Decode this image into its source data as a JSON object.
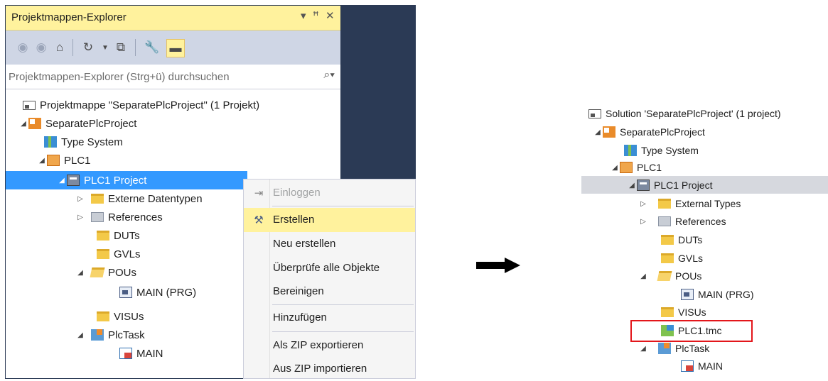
{
  "explorer": {
    "title": "Projektmappen-Explorer",
    "title_controls": [
      "▾",
      "ꟸ",
      "✕"
    ],
    "search_placeholder": "Projektmappen-Explorer (Strg+ü) durchsuchen",
    "tree": [
      {
        "label": "Projektmappe \"SeparatePlcProject\" (1 Projekt)",
        "icon": "solution-icon",
        "arrow": ""
      },
      {
        "label": "SeparatePlcProject",
        "icon": "project-icon",
        "arrow": "◢"
      },
      {
        "label": "Type System",
        "icon": "type-system-icon",
        "arrow": ""
      },
      {
        "label": "PLC1",
        "icon": "plc-icon",
        "arrow": "◢"
      },
      {
        "label": "PLC1 Project",
        "icon": "plc-project-icon",
        "arrow": "◢"
      },
      {
        "label": "Externe Datentypen",
        "icon": "folder-icon",
        "arrow": "▷"
      },
      {
        "label": "References",
        "icon": "references-icon",
        "arrow": "▷"
      },
      {
        "label": "DUTs",
        "icon": "folder-icon",
        "arrow": ""
      },
      {
        "label": "GVLs",
        "icon": "folder-icon",
        "arrow": ""
      },
      {
        "label": "POUs",
        "icon": "folder-open-icon",
        "arrow": "◢"
      },
      {
        "label": "MAIN (PRG)",
        "icon": "program-icon",
        "arrow": ""
      },
      {
        "label": "VISUs",
        "icon": "folder-icon",
        "arrow": ""
      },
      {
        "label": "PlcTask",
        "icon": "task-icon",
        "arrow": "◢"
      },
      {
        "label": "MAIN",
        "icon": "main-call-icon",
        "arrow": ""
      }
    ]
  },
  "context_menu": {
    "items": [
      {
        "label": "Einloggen",
        "icon": "login-icon",
        "disabled": true
      },
      {
        "label": "Erstellen",
        "icon": "build-icon",
        "highlighted": true
      },
      {
        "label": "Neu erstellen"
      },
      {
        "label": "Überprüfe alle Objekte"
      },
      {
        "label": "Bereinigen"
      },
      {
        "label": "Hinzufügen"
      },
      {
        "label": "Als ZIP exportieren"
      },
      {
        "label": "Aus ZIP importieren"
      }
    ]
  },
  "result_tree": [
    {
      "label": "Solution 'SeparatePlcProject' (1 project)",
      "icon": "solution-icon",
      "arrow": ""
    },
    {
      "label": "SeparatePlcProject",
      "icon": "project-icon",
      "arrow": "◢"
    },
    {
      "label": "Type System",
      "icon": "type-system-icon",
      "arrow": ""
    },
    {
      "label": "PLC1",
      "icon": "plc-icon",
      "arrow": "◢"
    },
    {
      "label": "PLC1 Project",
      "icon": "plc-project-icon",
      "arrow": "◢"
    },
    {
      "label": "External Types",
      "icon": "folder-icon",
      "arrow": "▷"
    },
    {
      "label": "References",
      "icon": "references-icon",
      "arrow": "▷"
    },
    {
      "label": "DUTs",
      "icon": "folder-icon",
      "arrow": ""
    },
    {
      "label": "GVLs",
      "icon": "folder-icon",
      "arrow": ""
    },
    {
      "label": "POUs",
      "icon": "folder-open-icon",
      "arrow": "◢"
    },
    {
      "label": "MAIN (PRG)",
      "icon": "program-icon",
      "arrow": ""
    },
    {
      "label": "VISUs",
      "icon": "folder-icon",
      "arrow": ""
    },
    {
      "label": "PLC1.tmc",
      "icon": "tmc-file-icon",
      "arrow": ""
    },
    {
      "label": "PlcTask",
      "icon": "task-icon",
      "arrow": "◢"
    },
    {
      "label": "MAIN",
      "icon": "main-call-icon",
      "arrow": ""
    }
  ],
  "colors": {
    "accent_yellow": "#fff29d",
    "selection_blue": "#3399ff",
    "highlight_red": "#e3161b",
    "panel_dark": "#2b3a55"
  }
}
